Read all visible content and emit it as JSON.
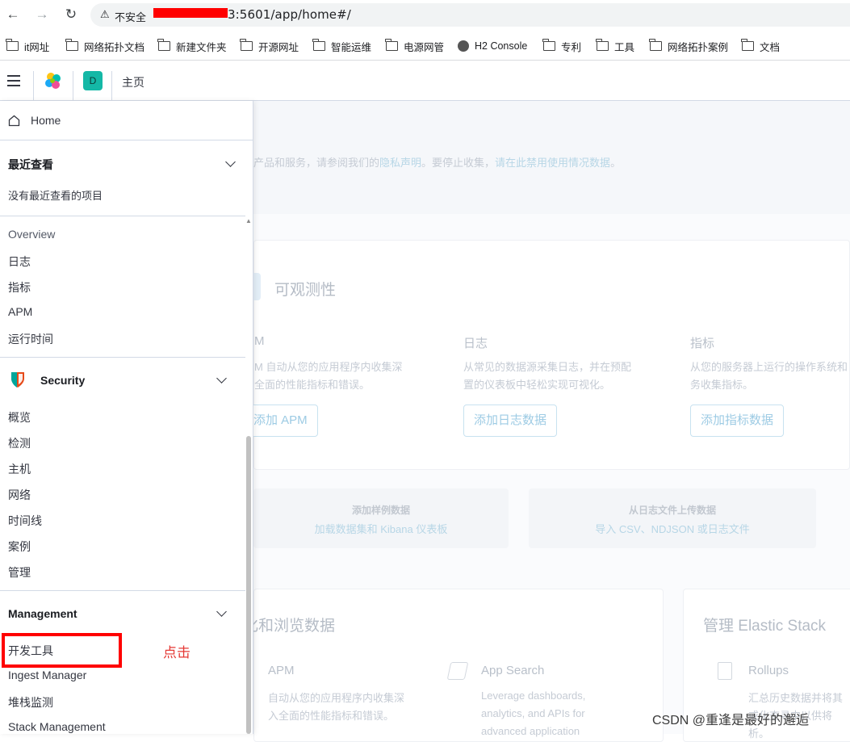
{
  "browser": {
    "insecure_label": "不安全",
    "url_visible": "3:5601/app/home#/",
    "bookmarks": [
      "it网址",
      "网络拓扑文档",
      "新建文件夹",
      "开源网址",
      "智能运维",
      "电源网管",
      "H2 Console",
      "专利",
      "工具",
      "网络拓扑案例",
      "文档"
    ]
  },
  "header": {
    "avatar_letter": "D",
    "breadcrumb": "主页"
  },
  "nav": {
    "home": "Home",
    "recent": {
      "title": "最近查看",
      "empty": "没有最近查看的项目"
    },
    "observability": [
      "Overview",
      "日志",
      "指标",
      "APM",
      "运行时间"
    ],
    "security": {
      "title": "Security",
      "items": [
        "概览",
        "检测",
        "主机",
        "网络",
        "时间线",
        "案例",
        "管理"
      ]
    },
    "management": {
      "title": "Management",
      "items": [
        "开发工具",
        "Ingest Manager",
        "堆栈监测",
        "Stack Management"
      ]
    }
  },
  "background": {
    "privacy_text_a": "产品和服务，请参阅我们的",
    "privacy_link_1": "隐私声明",
    "privacy_text_b": "。要停止收集，",
    "privacy_link_2": "请在此禁用使用情况数据",
    "privacy_text_c": "。",
    "observability_title": "可观测性",
    "col_apm_title": "M",
    "col_apm_desc_1": "M 自动从您的应用程序内收集深",
    "col_apm_desc_2": "全面的性能指标和错误。",
    "col_apm_btn": "添加 APM",
    "col_logs_title": "日志",
    "col_logs_desc_1": "从常见的数据源采集日志，并在预配",
    "col_logs_desc_2": "置的仪表板中轻松实现可视化。",
    "col_logs_btn": "添加日志数据",
    "col_metrics_title": "指标",
    "col_metrics_desc_1": "从您的服务器上运行的操作系统和",
    "col_metrics_desc_2": "务收集指标。",
    "col_metrics_btn": "添加指标数据",
    "sample_title": "添加样例数据",
    "sample_sub": "加载数据集和 Kibana 仪表板",
    "upload_title": "从日志文件上传数据",
    "upload_sub": "导入 CSV、NDJSON 或日志文件",
    "visualize_title": "化和浏览数据",
    "manage_title": "管理 Elastic Stack",
    "apm_tile_title": "APM",
    "apm_tile_desc_1": "自动从您的应用程序内收集深",
    "apm_tile_desc_2": "入全面的性能指标和错误。",
    "appsearch_title": "App Search",
    "appsearch_desc_1": "Leverage dashboards,",
    "appsearch_desc_2": "analytics, and APIs for",
    "appsearch_desc_3": "advanced application",
    "rollups_title": "Rollups",
    "rollups_desc_1": "汇总历史数据并将其",
    "rollups_desc_2": "或化查寻中以供将",
    "rollups_desc_3": "析。"
  },
  "annotation": {
    "click_note": "点击",
    "watermark": "CSDN @重逢是最好的邂逅"
  },
  "colors": {
    "highlight": "#ff0000",
    "avatar": "#14b8a6",
    "security_icon": "#e64a19"
  }
}
